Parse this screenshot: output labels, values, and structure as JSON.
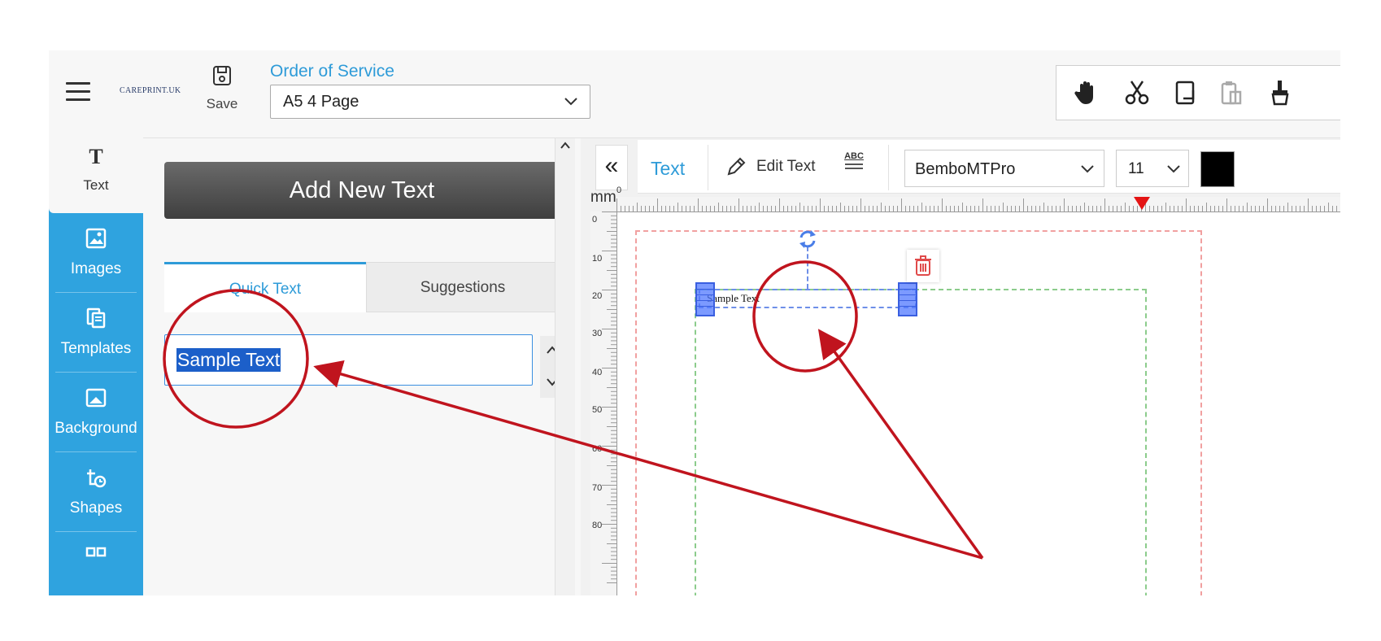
{
  "header": {
    "logo_text": "CAREPRINT.UK",
    "save_label": "Save",
    "document_title": "Order of Service",
    "document_format": "A5 4 Page"
  },
  "toolbar": {
    "icons": [
      "hand-icon",
      "cut-icon",
      "copy-icon",
      "paste-icon",
      "format-painter-icon"
    ]
  },
  "sidebar": {
    "items": [
      {
        "label": "Text",
        "icon": "text-icon"
      },
      {
        "label": "Images",
        "icon": "image-icon"
      },
      {
        "label": "Templates",
        "icon": "templates-icon"
      },
      {
        "label": "Background",
        "icon": "background-icon"
      },
      {
        "label": "Shapes",
        "icon": "shapes-icon"
      }
    ]
  },
  "text_panel": {
    "add_button": "Add New Text",
    "tabs": [
      "Quick Text",
      "Suggestions"
    ],
    "input_value": "Sample Text"
  },
  "text_toolbar": {
    "section_label": "Text",
    "edit_text_label": "Edit Text",
    "spellcheck_label": "ABC",
    "font": "BemboMTPro",
    "size": "11",
    "color": "#000000"
  },
  "canvas": {
    "unit_label": "mm",
    "ruler_zero": "0",
    "vertical_ticks": [
      "0",
      "10",
      "20",
      "30",
      "40",
      "50",
      "60",
      "70",
      "80"
    ],
    "element_text": "Sample Text"
  },
  "colors": {
    "accent": "#2e9bd8",
    "annotation": "#c0141e"
  }
}
